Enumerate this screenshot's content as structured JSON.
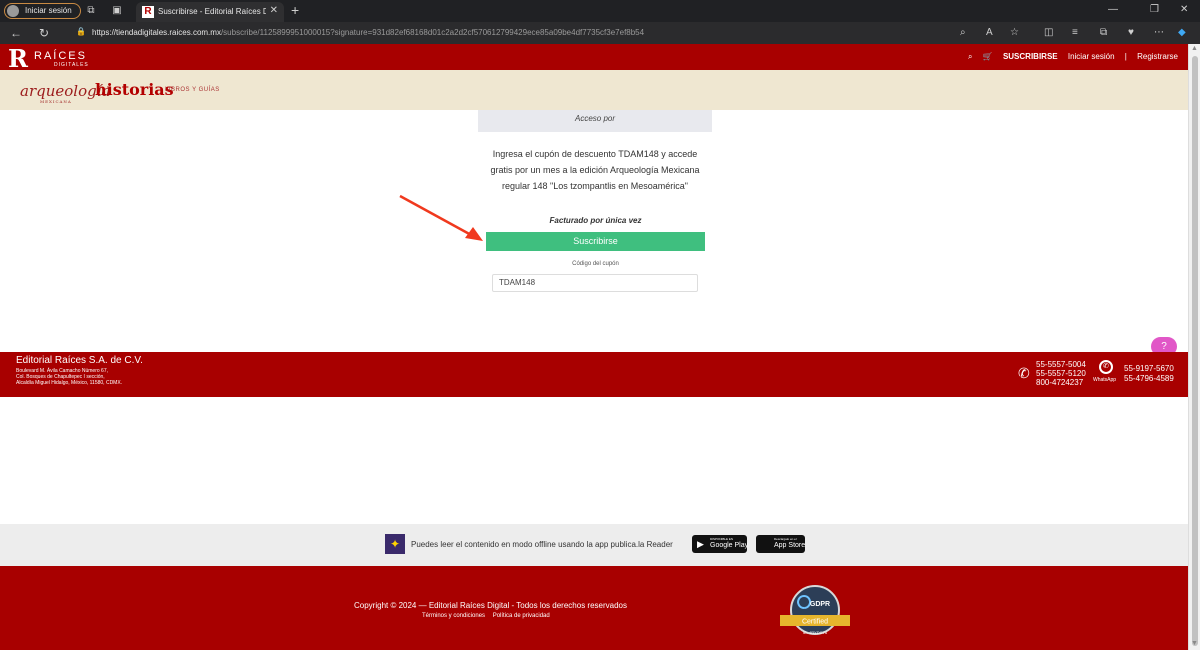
{
  "browser": {
    "profile_label": "Iniciar sesión",
    "tab_title": "Suscribirse - Editorial Raíces Digital",
    "tab_favicon": "R",
    "url_host": "https://tiendadigitales.raices.com.mx",
    "url_path": "/subscribe/1125899951000015?signature=931d82ef68168d01c2a2d2cf570612799429ece85a09be4df7735cf3e7ef8b54",
    "new_tab_symbol": "+"
  },
  "header": {
    "logo_letter": "R",
    "logo_name": "RAÍCES",
    "logo_sub": "DIGITALES",
    "subscribe_link": "SUSCRIBIRSE",
    "login_link": "Iniciar sesión",
    "separator": "|",
    "register_link": "Registrarse"
  },
  "subnav": {
    "brand1": "arqueología",
    "brand1_sub": "MEXICANA",
    "brand2": "historias",
    "brand3": "LIBROS Y GUÍAS"
  },
  "main": {
    "access_label": "Acceso por",
    "description": "Ingresa el cupón de descuento TDAM148 y accede gratis por un mes a la edición Arqueología Mexicana regular 148 \"Los tzompantlis en Mesoamérica\"",
    "billing_note": "Facturado por única vez",
    "subscribe_button": "Suscribirse",
    "coupon_label": "Código del cupón",
    "coupon_value": "TDAM148"
  },
  "footer": {
    "company": "Editorial Raíces S.A. de C.V.",
    "address_line1": "Boulevard M. Ávila Camacho Número 67,",
    "address_line2": "Col. Bosques de Chapultepec I sección,",
    "address_line3": "Alcaldía Miguel Hidalgo, México, 11580, CDMX.",
    "phone1": "55-5557-5004",
    "phone2": "55-5557-5120",
    "phone3": "800-4724237",
    "whatsapp_label": "WhatsApp",
    "wa_phone1": "55-9197-5670",
    "wa_phone2": "55-4796-4589"
  },
  "reader": {
    "text": "Puedes leer el contenido en modo offline usando la app publica.la Reader",
    "google_small": "DISPONIBLE EN",
    "google_big": "Google Play",
    "apple_small": "Descárgalo en el",
    "apple_big": "App Store"
  },
  "bottom": {
    "copyright": "Copyright © 2024 — Editorial Raíces Digital - Todos los derechos reservados",
    "terms": "Términos y condiciones",
    "privacy": "Política de privacidad",
    "gdpr_title": "GDPR",
    "gdpr_badge": "Certified",
    "gdpr_id": "ID: 4RYDCT6"
  },
  "colors": {
    "brand_red": "#a80000",
    "accent_green": "#3fbf7f",
    "help_pink": "#e157c7",
    "cream": "#efe7d1"
  }
}
